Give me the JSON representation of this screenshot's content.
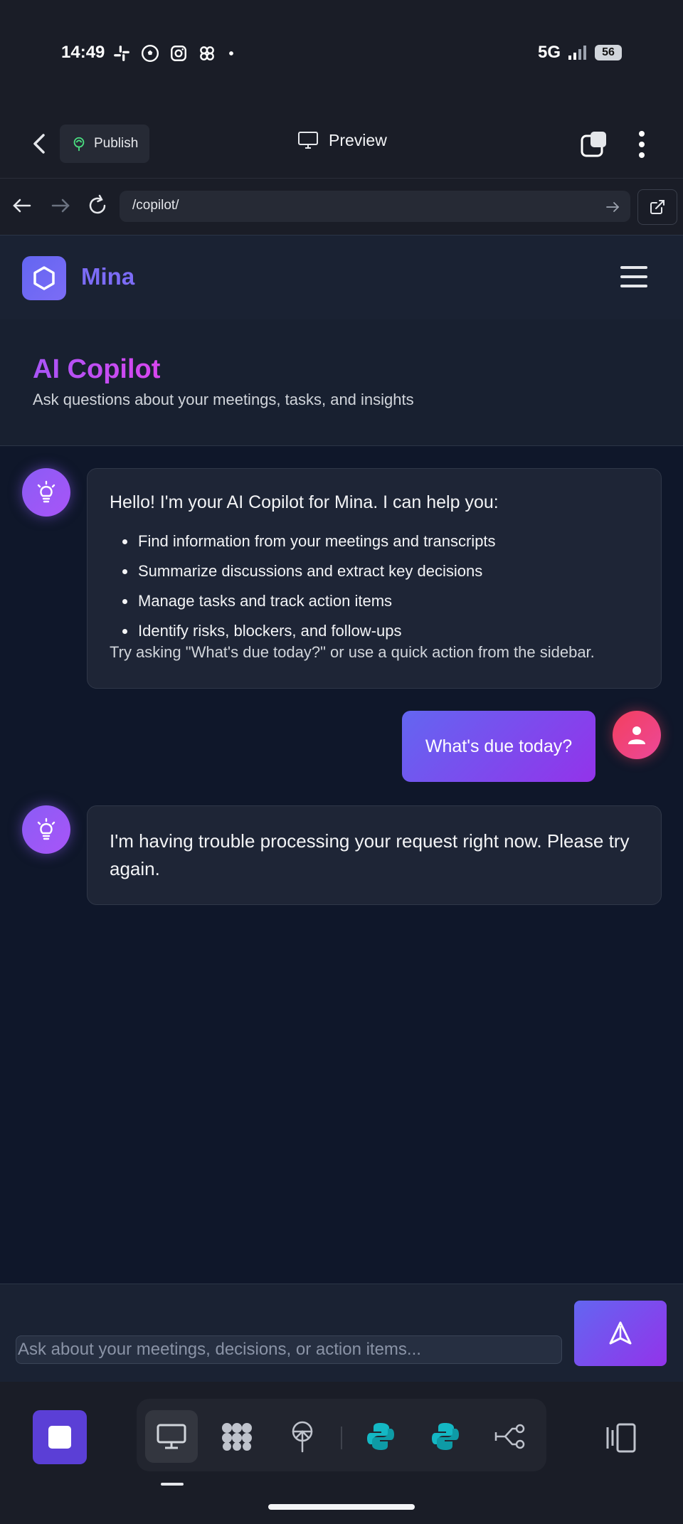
{
  "status_bar": {
    "time": "14:49",
    "network": "5G",
    "battery": "56"
  },
  "top_bar": {
    "publish_label": "Publish",
    "preview_label": "Preview"
  },
  "url_bar": {
    "url": "/copilot/"
  },
  "site": {
    "brand": "Mina"
  },
  "page": {
    "title": "AI Copilot",
    "subtitle": "Ask questions about your meetings, tasks, and insights"
  },
  "messages": {
    "welcome": {
      "title": "Hello! I'm your AI Copilot for Mina. I can help you:",
      "items": [
        "Find information from your meetings and transcripts",
        "Summarize discussions and extract key decisions",
        "Manage tasks and track action items",
        "Identify risks, blockers, and follow-ups"
      ],
      "footer": "Try asking \"What's due today?\" or use a quick action from the sidebar."
    },
    "user_question": "What's due today?",
    "error_reply": "I'm having trouble processing your request right now. Please try again."
  },
  "composer": {
    "placeholder": "Ask about your meetings, decisions, or action items..."
  },
  "colors": {
    "accent": "#7c6cf6",
    "bot_avatar": "#8b5cf6",
    "user_avatar": "#f43f5e",
    "title_gradient": "#a855f7"
  }
}
